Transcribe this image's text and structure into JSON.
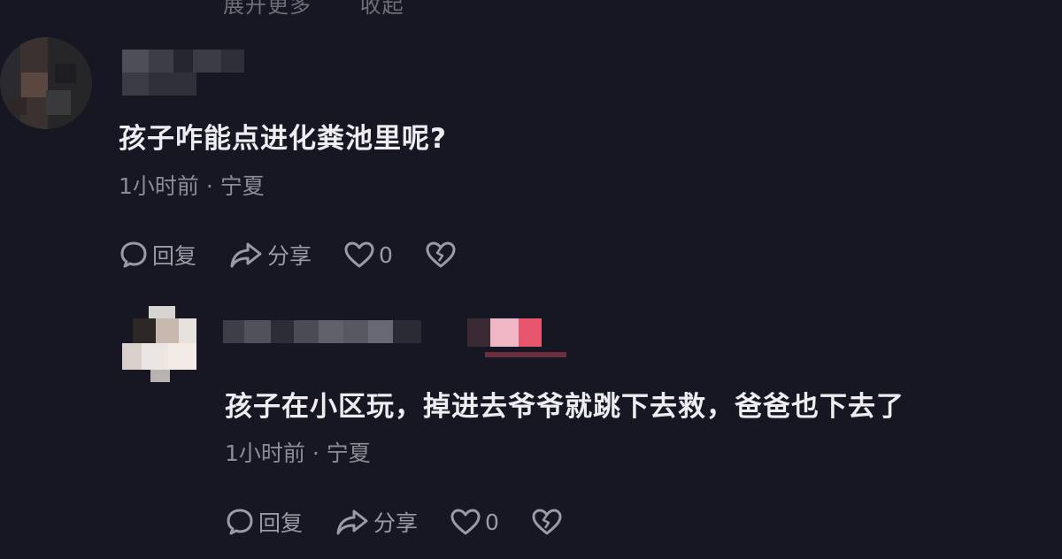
{
  "top_bar": {
    "expand_more": "展开更多",
    "collapse": "收起"
  },
  "comments": [
    {
      "text": "孩子咋能点进化粪池里呢?",
      "time": "1小时前",
      "separator": "·",
      "location": "宁夏",
      "reply_label": "回复",
      "share_label": "分享",
      "like_count": "0"
    },
    {
      "text": "孩子在小区玩，掉进去爷爷就跳下去救，爸爸也下去了",
      "time": "1小时前",
      "separator": "·",
      "location": "宁夏",
      "reply_label": "回复",
      "share_label": "分享",
      "like_count": "0"
    }
  ],
  "icons": {
    "reply": "comment-bubble-icon",
    "share": "share-arrow-icon",
    "like": "heart-outline-icon",
    "dislike": "broken-heart-icon"
  },
  "colors": {
    "background": "#161722",
    "text": "#ececf1",
    "meta": "#8b8c96",
    "action": "#9a9ba5",
    "badge": "#e8566e"
  }
}
